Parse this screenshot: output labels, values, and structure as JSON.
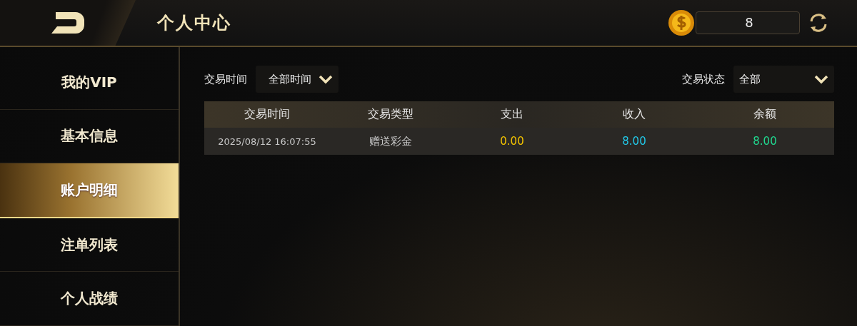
{
  "header": {
    "title": "个人中心",
    "balance": "8"
  },
  "sidebar": {
    "items": [
      {
        "label": "我的VIP",
        "selected": false
      },
      {
        "label": "基本信息",
        "selected": false
      },
      {
        "label": "账户明细",
        "selected": true
      },
      {
        "label": "注单列表",
        "selected": false
      },
      {
        "label": "个人战绩",
        "selected": false
      }
    ]
  },
  "filters": [
    {
      "label": "交易时间",
      "value": "全部时间"
    },
    {
      "label": "交易状态",
      "value": "全部"
    }
  ],
  "table": {
    "columns": [
      "交易时间",
      "交易类型",
      "支出",
      "收入",
      "余额"
    ],
    "rows": [
      {
        "cells": [
          {
            "text": "2025/08/12 16:07:55",
            "color": "#c8c8c8"
          },
          {
            "text": "赠送彩金",
            "color": "#c8c8c8"
          },
          {
            "text": "0.00",
            "color": "#f2c200"
          },
          {
            "text": "8.00",
            "color": "#22c8e8"
          },
          {
            "text": "8.00",
            "color": "#20d890"
          }
        ]
      }
    ]
  }
}
